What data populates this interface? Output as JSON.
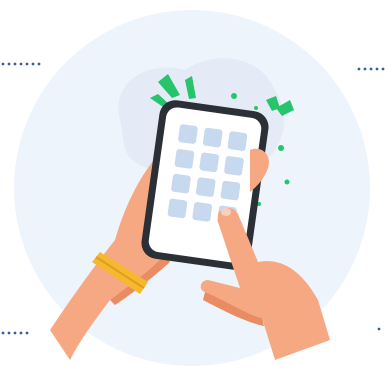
{
  "illustration": {
    "subject": "hands-holding-smartphone",
    "icons": [
      "phone-icon",
      "app-grid-icon",
      "tap-finger-icon",
      "sparkle-icon",
      "wristband-icon"
    ],
    "colors": {
      "background": "#ffffff",
      "circle": "#eef4fb",
      "blob": "#e4ebf6",
      "phone_body": "#2b2f36",
      "screen": "#ffffff",
      "app_tile": "#c7d9ef",
      "skin": "#f6a882",
      "skin_shadow": "#e98c63",
      "wristband": "#f5b82e",
      "sparkle": "#27c46b",
      "dots": "#3b5b9e"
    },
    "app_grid": {
      "rows": 4,
      "cols": 3
    }
  }
}
